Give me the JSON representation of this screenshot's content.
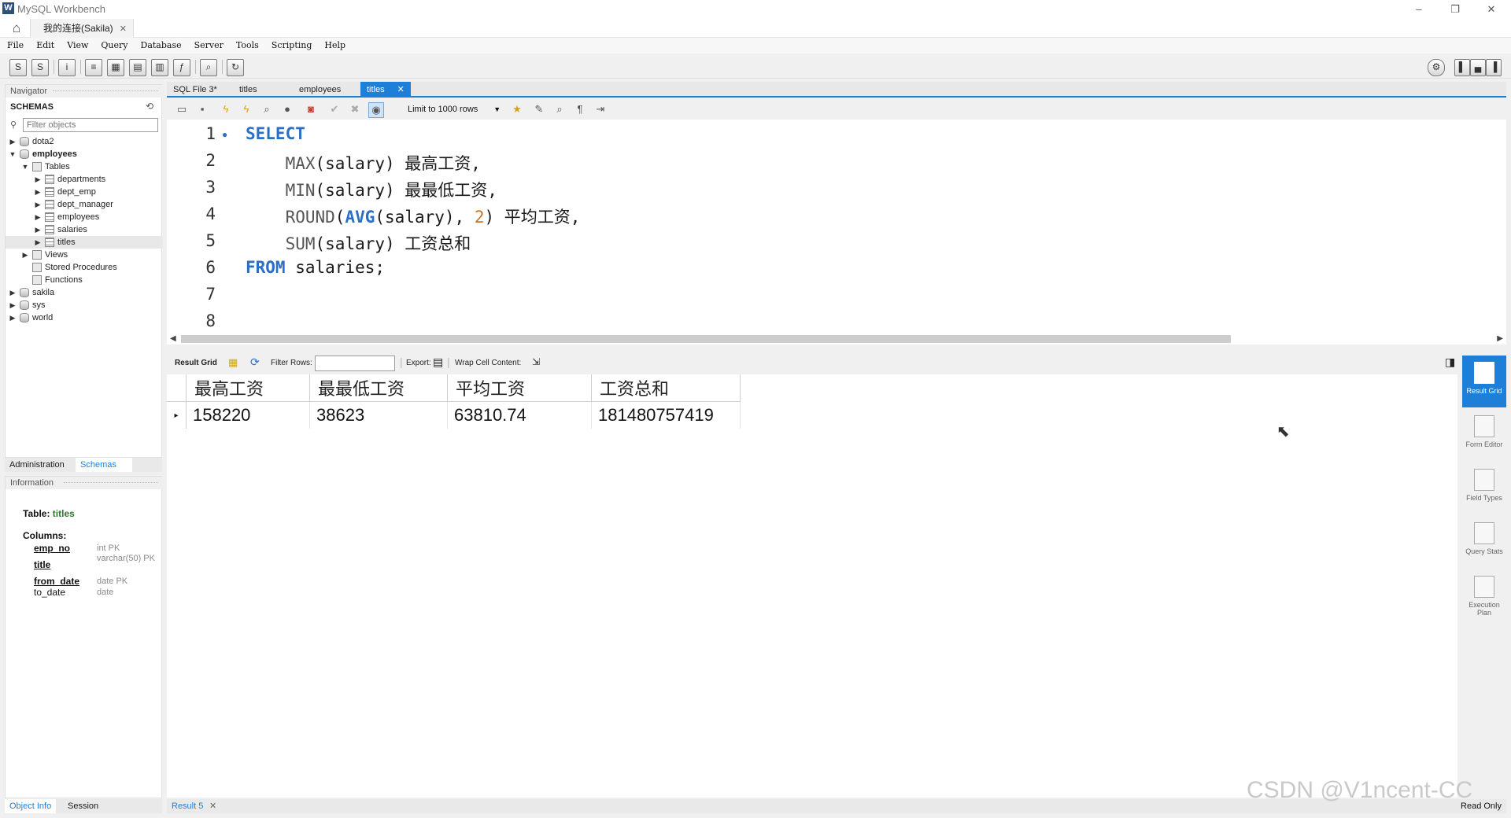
{
  "window": {
    "title": "MySQL Workbench",
    "minimize": "–",
    "restore": "❐",
    "close": "✕"
  },
  "connection_tab": {
    "label": "我的连接(Sakila)",
    "close": "✕",
    "home_icon": "⌂"
  },
  "menu": [
    "File",
    "Edit",
    "View",
    "Query",
    "Database",
    "Server",
    "Tools",
    "Scripting",
    "Help"
  ],
  "navigator": {
    "title": "Navigator",
    "schemas_label": "SCHEMAS",
    "filter_placeholder": "Filter objects",
    "tree": [
      {
        "label": "dota2",
        "level": 0,
        "kind": "db",
        "expanded": false
      },
      {
        "label": "employees",
        "level": 0,
        "kind": "db",
        "expanded": true,
        "bold": true
      },
      {
        "label": "Tables",
        "level": 1,
        "kind": "folder",
        "expanded": true
      },
      {
        "label": "departments",
        "level": 2,
        "kind": "table",
        "expanded": false
      },
      {
        "label": "dept_emp",
        "level": 2,
        "kind": "table",
        "expanded": false
      },
      {
        "label": "dept_manager",
        "level": 2,
        "kind": "table",
        "expanded": false
      },
      {
        "label": "employees",
        "level": 2,
        "kind": "table",
        "expanded": false
      },
      {
        "label": "salaries",
        "level": 2,
        "kind": "table",
        "expanded": false
      },
      {
        "label": "titles",
        "level": 2,
        "kind": "table",
        "expanded": false,
        "selected": true
      },
      {
        "label": "Views",
        "level": 1,
        "kind": "folder",
        "expanded": false
      },
      {
        "label": "Stored Procedures",
        "level": 1,
        "kind": "folder",
        "leaf": true
      },
      {
        "label": "Functions",
        "level": 1,
        "kind": "folder",
        "leaf": true
      },
      {
        "label": "sakila",
        "level": 0,
        "kind": "db",
        "expanded": false
      },
      {
        "label": "sys",
        "level": 0,
        "kind": "db",
        "expanded": false
      },
      {
        "label": "world",
        "level": 0,
        "kind": "db",
        "expanded": false
      }
    ],
    "tabs": {
      "administration": "Administration",
      "schemas": "Schemas"
    }
  },
  "information": {
    "title": "Information",
    "table_prefix": "Table: ",
    "table_name": "titles",
    "columns_label": "Columns:",
    "columns": [
      {
        "name": "emp_no",
        "type": "int PK",
        "pk": true
      },
      {
        "name": "title",
        "type": "varchar(50) PK",
        "pk": true
      },
      {
        "name": "from_date",
        "type": "date PK",
        "pk": true
      },
      {
        "name": "to_date",
        "type": "date",
        "pk": false
      }
    ],
    "tabs": {
      "object_info": "Object Info",
      "session": "Session"
    }
  },
  "editor_tabs": [
    {
      "label": "SQL File 3*",
      "active": false
    },
    {
      "label": "titles",
      "active": false
    },
    {
      "label": "employees",
      "active": false
    },
    {
      "label": "titles",
      "active": true,
      "close": "✕"
    }
  ],
  "sql_toolbar": {
    "limit_label": "Limit to 1000 rows"
  },
  "editor": {
    "line_numbers": [
      "1",
      "2",
      "3",
      "4",
      "5",
      "6",
      "7",
      "8"
    ],
    "lines": [
      [
        {
          "t": "SELECT",
          "c": "kw"
        }
      ],
      [
        {
          "t": "    MAX",
          "c": "fn"
        },
        {
          "t": "(salary) 最高工资,",
          "c": ""
        }
      ],
      [
        {
          "t": "    MIN",
          "c": "fn"
        },
        {
          "t": "(salary) 最最低工资,",
          "c": ""
        }
      ],
      [
        {
          "t": "    ROUND",
          "c": "fn"
        },
        {
          "t": "(",
          "c": ""
        },
        {
          "t": "AVG",
          "c": "kw"
        },
        {
          "t": "(salary), ",
          "c": ""
        },
        {
          "t": "2",
          "c": "num"
        },
        {
          "t": ") 平均工资,",
          "c": ""
        }
      ],
      [
        {
          "t": "    SUM",
          "c": "fn"
        },
        {
          "t": "(salary) 工资总和",
          "c": ""
        }
      ],
      [
        {
          "t": "FROM",
          "c": "kw"
        },
        {
          "t": " salaries;",
          "c": ""
        }
      ],
      [],
      []
    ]
  },
  "result_toolbar": {
    "result_grid": "Result Grid",
    "filter_rows": "Filter Rows:",
    "export": "Export:",
    "wrap": "Wrap Cell Content:"
  },
  "result": {
    "columns": [
      "最高工资",
      "最最低工资",
      "平均工资",
      "工资总和"
    ],
    "rows": [
      [
        "158220",
        "38623",
        "63810.74",
        "181480757419"
      ]
    ]
  },
  "side_panel": [
    {
      "label": "Result Grid",
      "active": true
    },
    {
      "label": "Form Editor",
      "active": false
    },
    {
      "label": "Field Types",
      "active": false
    },
    {
      "label": "Query Stats",
      "active": false
    },
    {
      "label": "Execution Plan",
      "active": false
    }
  ],
  "bottom": {
    "result_tab": "Result 5",
    "close": "✕",
    "read_only": "Read Only"
  },
  "watermark": "CSDN @V1ncent-CC"
}
